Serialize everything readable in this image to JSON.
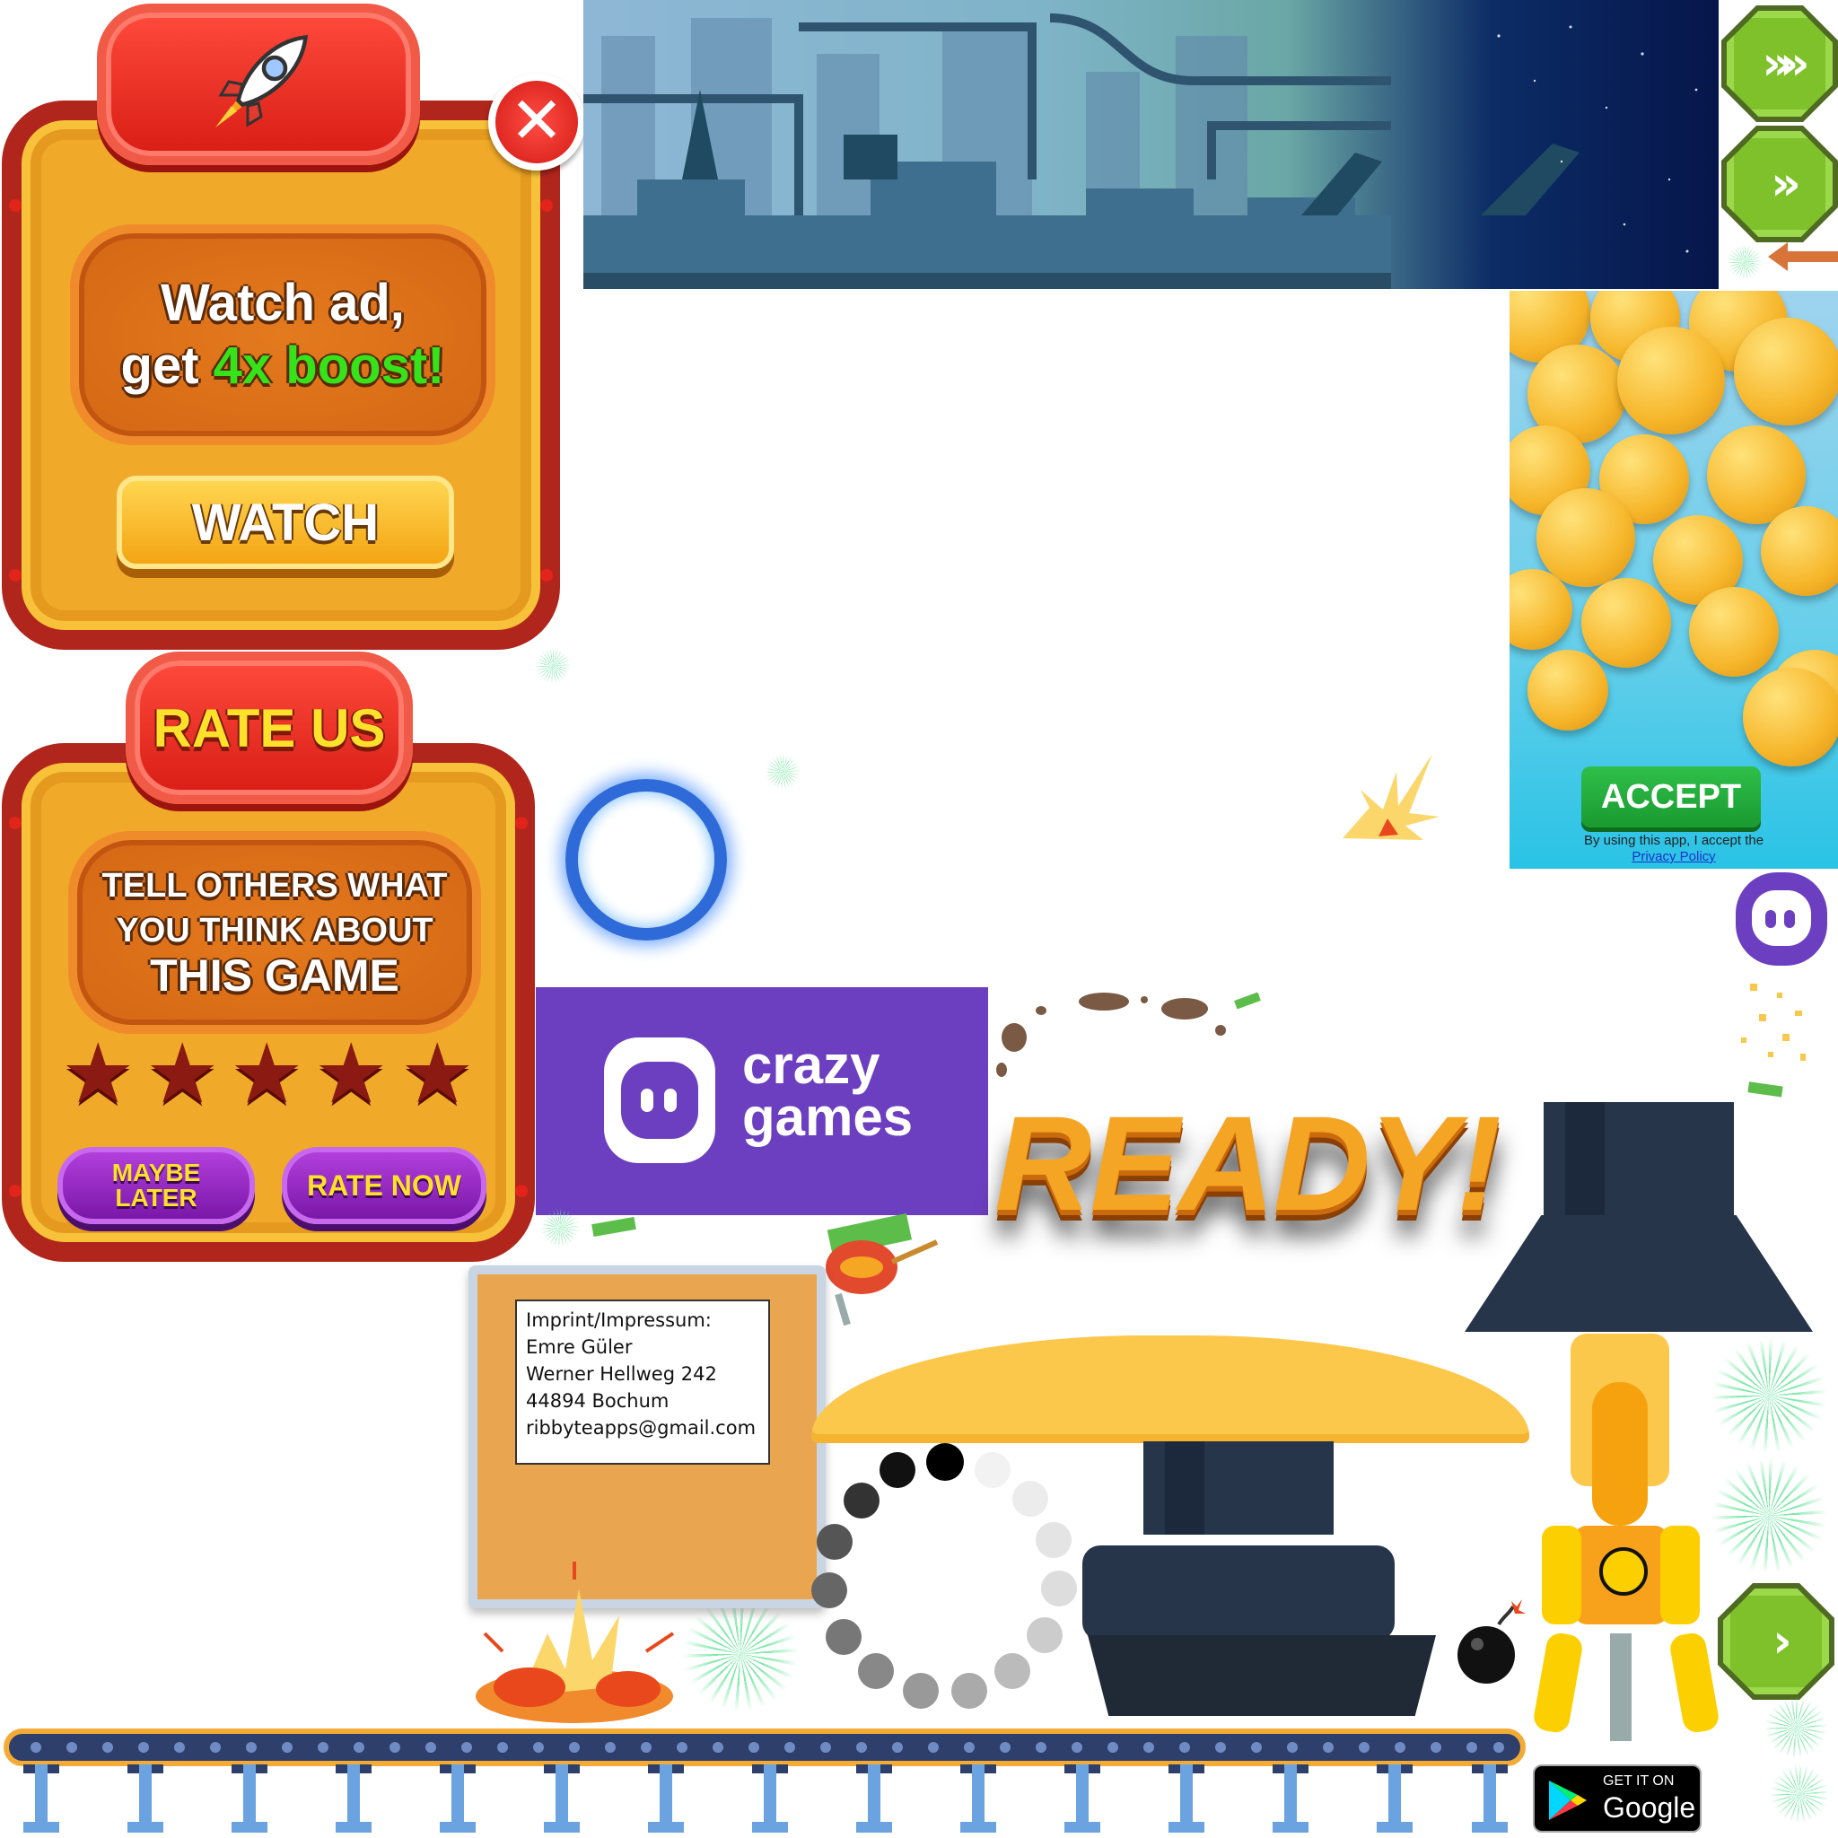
{
  "watch_popup": {
    "line1": "Watch ad,",
    "line2_prefix": "get ",
    "line2_highlight": "4x boost!",
    "button": "WATCH",
    "icon": "rocket-icon",
    "close_icon": "close-icon"
  },
  "rate_popup": {
    "title": "RATE US",
    "body_line1": "TELL OTHERS WHAT",
    "body_line2": "YOU THINK ABOUT",
    "body_line3": "THIS GAME",
    "stars": 5,
    "maybe_later": "MAYBE LATER",
    "rate_now": "RATE NOW"
  },
  "emoji_ad": {
    "accept": "ACCEPT",
    "disclaimer": "By using this app, I accept the",
    "privacy_link": "Privacy Policy"
  },
  "crazygames": {
    "line1": "crazy",
    "line2": "games"
  },
  "ready_text": "READY!",
  "imprint": {
    "l1": "Imprint/Impressum:",
    "l2": "Emre Güler",
    "l3": "Werner Hellweg 242",
    "l4": "44894 Bochum",
    "l5": "ribbyteapps@gmail.com"
  },
  "google_play": {
    "small": "GET IT ON",
    "big": "Google Play"
  },
  "colors": {
    "panel": "#f0a928",
    "panel_border": "#b0261c",
    "accent_red": "#e2241b",
    "boost_green": "#36e31a",
    "purple": "#6c3fc0",
    "hex_green": "#7ec12a"
  }
}
